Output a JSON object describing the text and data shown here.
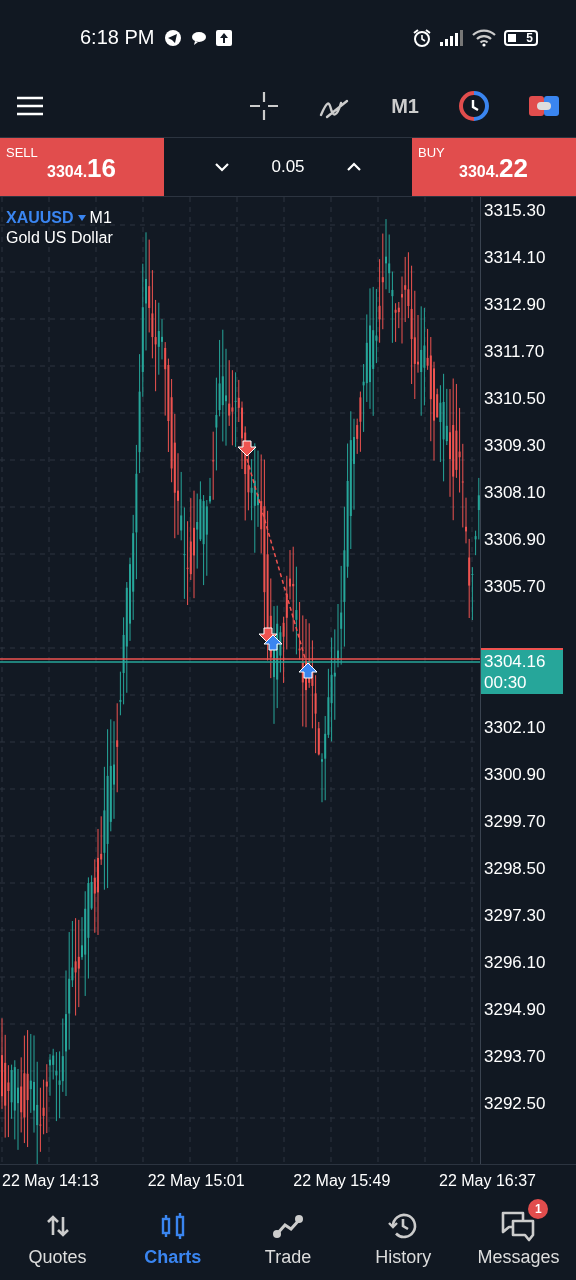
{
  "status_bar": {
    "time": "6:18 PM",
    "battery": "5"
  },
  "toolbar": {
    "timeframe": "M1"
  },
  "trade_bar": {
    "sell": {
      "label": "SELL",
      "price_main": "3304.",
      "price_tail": "16"
    },
    "volume": "0.05",
    "buy": {
      "label": "BUY",
      "price_main": "3304.",
      "price_tail": "22"
    }
  },
  "chart": {
    "symbol": "XAUUSD",
    "timeframe": "M1",
    "description": "Gold US Dollar",
    "y_axis": [
      {
        "kind": "label",
        "text": "3315.30"
      },
      {
        "kind": "label",
        "text": "3314.10"
      },
      {
        "kind": "label",
        "text": "3312.90"
      },
      {
        "kind": "label",
        "text": "3311.70"
      },
      {
        "kind": "label",
        "text": "3310.50"
      },
      {
        "kind": "label",
        "text": "3309.30"
      },
      {
        "kind": "label",
        "text": "3308.10"
      },
      {
        "kind": "label",
        "text": "3306.90"
      },
      {
        "kind": "label",
        "text": "3305.70"
      },
      {
        "kind": "tag",
        "price": "3304.16",
        "countdown": "00:30"
      },
      {
        "kind": "label",
        "text": "3302.10"
      },
      {
        "kind": "label",
        "text": "3300.90"
      },
      {
        "kind": "label",
        "text": "3299.70"
      },
      {
        "kind": "label",
        "text": "3298.50"
      },
      {
        "kind": "label",
        "text": "3297.30"
      },
      {
        "kind": "label",
        "text": "3296.10"
      },
      {
        "kind": "label",
        "text": "3294.90"
      },
      {
        "kind": "label",
        "text": "3293.70"
      },
      {
        "kind": "label",
        "text": "3292.50"
      }
    ],
    "x_axis": [
      "22 May 14:13",
      "22 May 15:01",
      "22 May 15:49",
      "22 May 16:37"
    ]
  },
  "nav": [
    {
      "label": "Quotes",
      "selected": false
    },
    {
      "label": "Charts",
      "selected": true
    },
    {
      "label": "Trade",
      "selected": false
    },
    {
      "label": "History",
      "selected": false
    },
    {
      "label": "Messages",
      "selected": false,
      "badge": "1"
    }
  ]
}
